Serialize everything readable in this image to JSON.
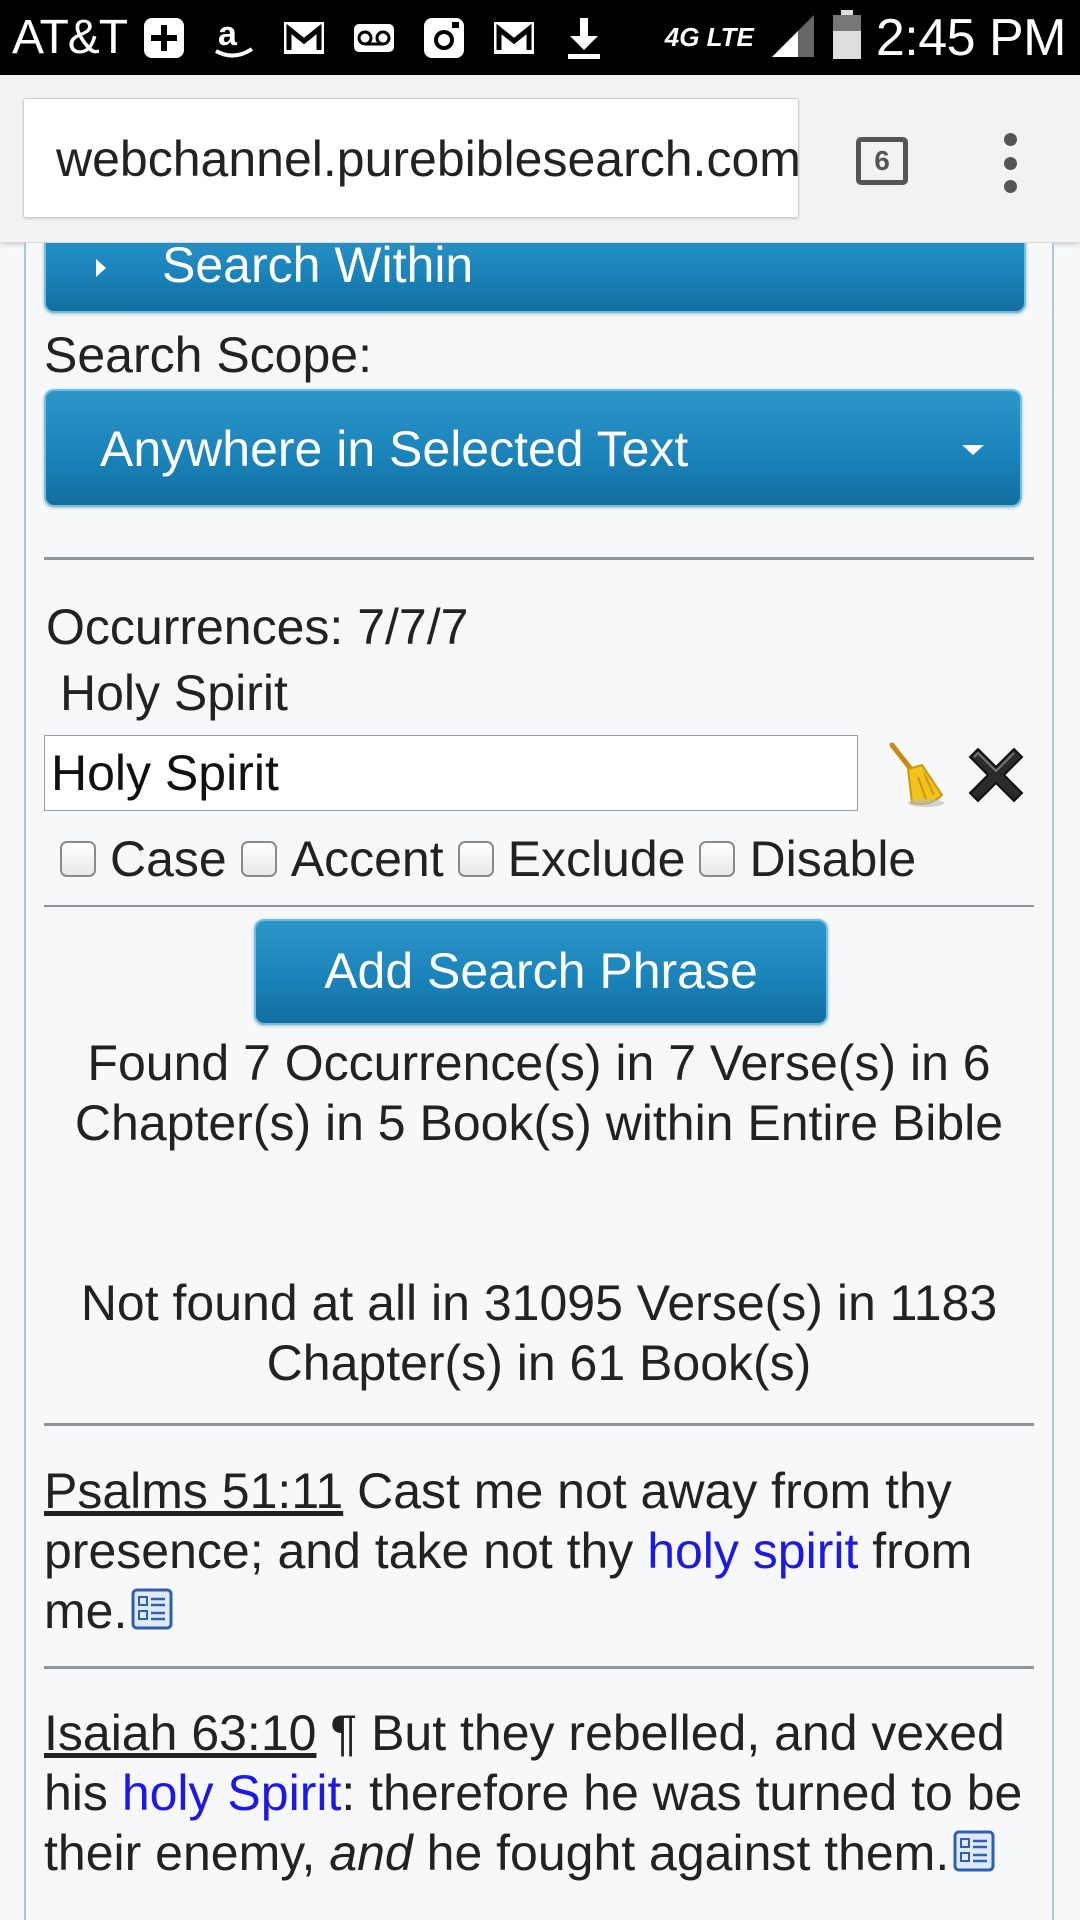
{
  "status_bar": {
    "carrier": "AT&T",
    "network": "4G LTE",
    "time": "2:45 PM",
    "icons": [
      "plus-box-icon",
      "amazon-icon",
      "gmail-icon",
      "voicemail-icon",
      "instagram-icon",
      "gmail-icon",
      "download-icon"
    ]
  },
  "browser": {
    "url": "webchannel.purebiblesearch.com",
    "tab_count": "6"
  },
  "search_within": {
    "label": "Search Within"
  },
  "scope": {
    "label": "Search Scope:",
    "selected": "Anywhere in Selected Text"
  },
  "phrase": {
    "occurrences": "Occurrences: 7/7/7",
    "title": "Holy Spirit",
    "value": "Holy Spirit",
    "options": {
      "case": "Case",
      "accent": "Accent",
      "exclude": "Exclude",
      "disable": "Disable"
    }
  },
  "add_button": "Add Search Phrase",
  "results": {
    "found": "Found 7 Occurrence(s) in 7 Verse(s) in 6 Chapter(s) in 5 Book(s) within Entire Bible",
    "not_found": "Not found at all in 31095 Verse(s) in 1183 Chapter(s) in 61 Book(s)"
  },
  "verses": [
    {
      "ref": "Psalms 51:11",
      "pre": " Cast me not away from thy presence; and take not thy ",
      "highlight": "holy spirit",
      "post": " from me."
    },
    {
      "ref": "Isaiah 63:10",
      "pre": " ¶ But they rebelled, and vexed his ",
      "highlight": "holy Spirit",
      "post1": ": therefore he was turned to be their enemy, ",
      "italic": "and",
      "post2": " he fought against them."
    }
  ]
}
